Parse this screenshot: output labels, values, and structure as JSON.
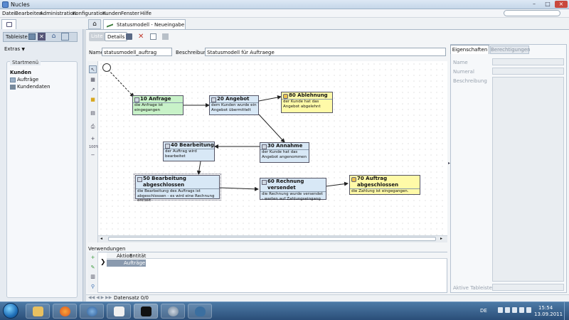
{
  "window": {
    "title": "Nucles"
  },
  "menubar": {
    "items": [
      "Datei",
      "Bearbeiten",
      "Administration",
      "Konfiguration",
      "Kunden",
      "Fenster",
      "Hilfe"
    ]
  },
  "left": {
    "tableiste_label": "Tableiste",
    "extras_label": "Extras",
    "start_title": "Startmenü",
    "kunden_title": "Kunden",
    "items": [
      "Aufträge",
      "Kundendaten"
    ]
  },
  "tabs": {
    "doc_tab_label": "Statusmodell - Neueingabe (Gas"
  },
  "toolbar": {
    "liste_label": "Liste",
    "details_label": "Details"
  },
  "form": {
    "name_label": "Name",
    "name_value": "statusmodell_auftrag",
    "beschreibung_label": "Beschreibung",
    "beschreibung_value": "Statusmodell für Auftraege"
  },
  "tools": {
    "zoom_label": "100%"
  },
  "diagram": {
    "nodes": [
      {
        "title": "10 Anfrage",
        "desc": "die Anfrage ist eingegangen"
      },
      {
        "title": "20 Angebot",
        "desc": "dem Kunden wurde ein Angebot übermittelt"
      },
      {
        "title": "80 Ablehnung",
        "desc": "der Kunde hat das Angebot abgelehnt"
      },
      {
        "title": "30 Annahme",
        "desc": "der Kunde hat das Angebot angenommen"
      },
      {
        "title": "40 Bearbeitung",
        "desc": "der Auftrag wird bearbeitet"
      },
      {
        "title": "50 Bearbeitung abgeschlossen",
        "desc": "die Bearbeitung des Auftrags ist abgeschlossen - es wird eine Rechnung erstellt"
      },
      {
        "title": "60 Rechnung versendet",
        "desc": "die Rechnung wurde versendet - warten auf Zahlungseingang"
      },
      {
        "title": "70 Auftrag abgeschlossen",
        "desc": "die Zahlung ist eingegangen."
      }
    ]
  },
  "verwendungen": {
    "label": "Verwendungen",
    "columns": [
      "Aktion",
      "Entität"
    ],
    "rows": [
      {
        "entitaet": "Aufträge"
      }
    ]
  },
  "status": {
    "text": "Datensatz 0/0"
  },
  "right_panel": {
    "tab_eigenschaften": "Eigenschaften",
    "tab_berechtigungen": "Berechtigungen",
    "name_label": "Name",
    "numeral_label": "Numeral",
    "beschreibung_label": "Beschreibung",
    "aktive_tableiste_label": "Aktive Tableiste"
  },
  "taskbar": {
    "lang": "DE",
    "time": "15:54",
    "date": "13.09.2011"
  },
  "colors": {
    "green_node": "#c8f2c8",
    "blue_node": "#d8e8f6",
    "yellow_node": "#fffaa8",
    "taskbar": "#2a4e78"
  }
}
